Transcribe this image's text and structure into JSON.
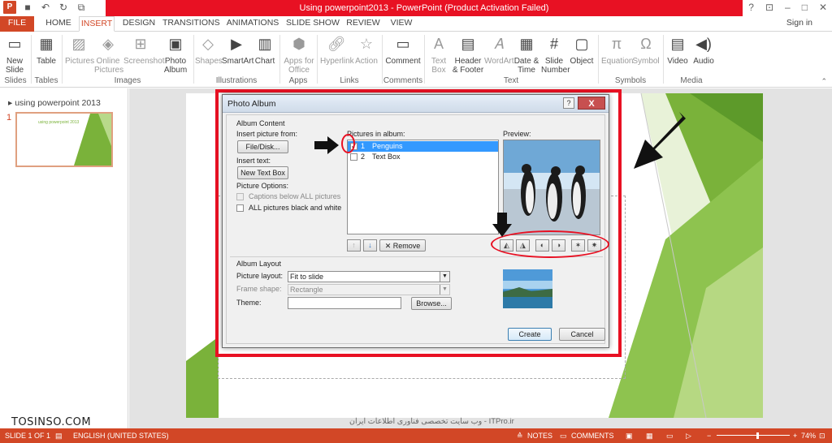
{
  "app": {
    "title": "Using powerpoint2013 -  PowerPoint (Product Activation Failed)",
    "logo": "P",
    "signin": "Sign in"
  },
  "tabs": [
    "FILE",
    "HOME",
    "INSERT",
    "DESIGN",
    "TRANSITIONS",
    "ANIMATIONS",
    "SLIDE SHOW",
    "REVIEW",
    "VIEW"
  ],
  "ribbon": {
    "new_slide": "New Slide",
    "table": "Table",
    "pictures": "Pictures",
    "online_pictures": "Online Pictures",
    "screenshot": "Screenshot",
    "photo_album": "Photo Album",
    "shapes": "Shapes",
    "smartart": "SmartArt",
    "chart": "Chart",
    "apps_for_office": "Apps for Office",
    "hyperlink": "Hyperlink",
    "action": "Action",
    "comment": "Comment",
    "text_box": "Text Box",
    "header_footer": "Header & Footer",
    "wordart": "WordArt",
    "date_time": "Date & Time",
    "slide_number": "Slide Number",
    "object": "Object",
    "equation": "Equation",
    "symbol": "Symbol",
    "video": "Video",
    "audio": "Audio",
    "groups": {
      "slides": "Slides",
      "tables": "Tables",
      "images": "Images",
      "illustrations": "Illustrations",
      "apps": "Apps",
      "links": "Links",
      "comments": "Comments",
      "text": "Text",
      "symbols": "Symbols",
      "media": "Media"
    }
  },
  "left_panel": {
    "section": "using powerpoint 2013",
    "slide_number": "1",
    "thumb_text": "using powerpoint 2013"
  },
  "dialog": {
    "title": "Photo Album",
    "help": "?",
    "close": "X",
    "album_content": "Album Content",
    "insert_picture_from": "Insert picture from:",
    "file_disk": "File/Disk...",
    "insert_text": "Insert text:",
    "new_text_box": "New Text Box",
    "picture_options": "Picture Options:",
    "captions_below": "Captions below ALL pictures",
    "all_black_white": "ALL pictures black and white",
    "pictures_in_album": "Pictures in album:",
    "items": [
      {
        "num": "1",
        "name": "Penguins",
        "checked": true
      },
      {
        "num": "2",
        "name": "Text Box",
        "checked": false
      }
    ],
    "remove": "Remove",
    "preview": "Preview:",
    "album_layout": "Album Layout",
    "picture_layout_label": "Picture layout:",
    "picture_layout_value": "Fit to slide",
    "frame_shape_label": "Frame shape:",
    "frame_shape_value": "Rectangle",
    "theme_label": "Theme:",
    "theme_value": "",
    "browse": "Browse...",
    "create": "Create",
    "cancel": "Cancel"
  },
  "status": {
    "slide_of": "SLIDE 1 OF 1",
    "language": "ENGLISH (UNITED STATES)",
    "notes": "NOTES",
    "comments": "COMMENTS",
    "zoom": "74%",
    "zoom_level": 0.55
  },
  "watermark": {
    "brand": "TOSINSO.COM",
    "site": "وب سایت تخصصی فناوری اطلاعات ایران - ITPro.ir"
  },
  "colors": {
    "accent": "#d24726",
    "title_bar": "#e81123",
    "annotation": "#e81123",
    "slide_green": "#7ab23a"
  }
}
